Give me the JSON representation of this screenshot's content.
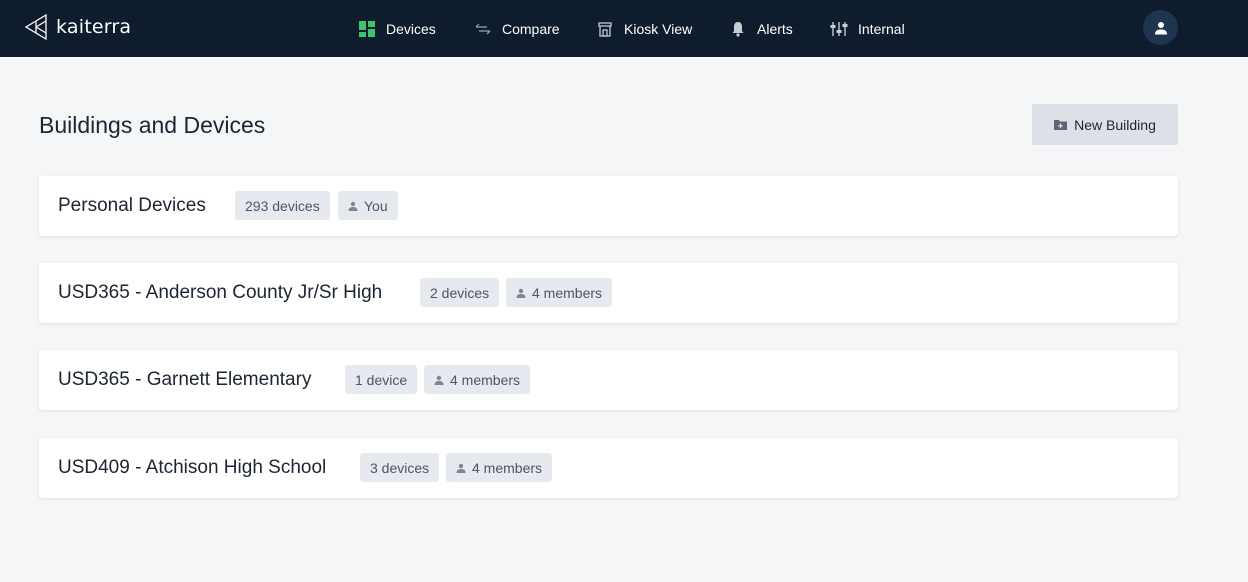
{
  "header": {
    "logo_text": "kaiterra",
    "nav": [
      {
        "label": "Devices",
        "icon": "grid-icon"
      },
      {
        "label": "Compare",
        "icon": "compare-arrows-icon"
      },
      {
        "label": "Kiosk View",
        "icon": "kiosk-icon"
      },
      {
        "label": "Alerts",
        "icon": "bell-icon"
      },
      {
        "label": "Internal",
        "icon": "sliders-icon"
      }
    ],
    "avatar_icon": "user-icon"
  },
  "main": {
    "title": "Buildings and Devices",
    "new_building_label": "New Building",
    "buildings": [
      {
        "name": "Personal Devices",
        "devices": "293 devices",
        "members": "You"
      },
      {
        "name": "USD365 - Anderson County Jr/Sr High",
        "devices": "2 devices",
        "members": "4 members"
      },
      {
        "name": "USD365 - Garnett Elementary",
        "devices": "1 device",
        "members": "4 members"
      },
      {
        "name": "USD409 - Atchison High School",
        "devices": "3 devices",
        "members": "4 members"
      }
    ]
  },
  "colors": {
    "topbar": "#0f1c2e",
    "accent_green": "#3ec46d",
    "background": "#f5f6f8",
    "pill": "#e6e9ee",
    "button": "#dde1e7"
  }
}
